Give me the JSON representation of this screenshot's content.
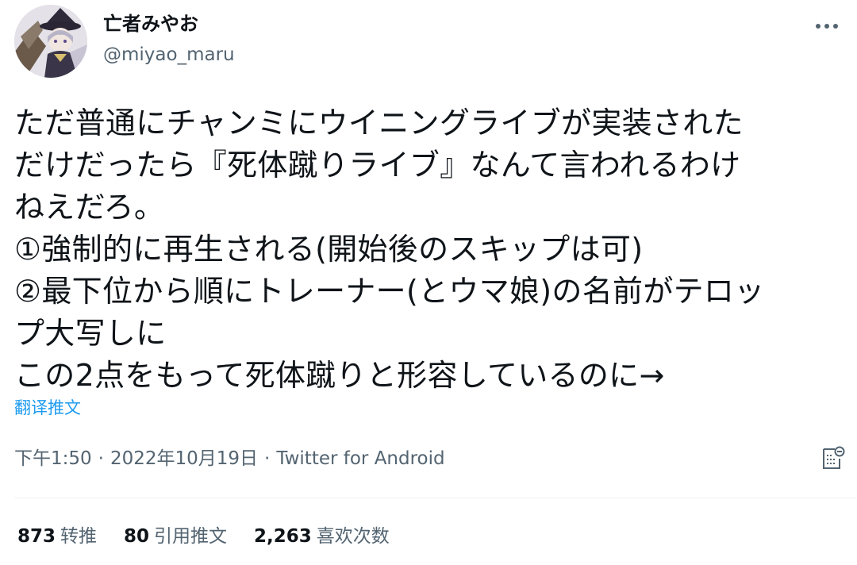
{
  "user": {
    "display_name": "亡者みやお",
    "handle": "@miyao_maru",
    "avatar_icon": "user-avatar"
  },
  "tweet": {
    "text": "ただ普通にチャンミにウイニングライブが実装された\nだけだったら『死体蹴りライブ』なんて言われるわけ\nねえだろ。\n①強制的に再生される(開始後のスキップは可)\n②最下位から順にトレーナー(とウマ娘)の名前がテロッ\nプ大写しに\nこの2点をもって死体蹴りと形容しているのに→",
    "translate_label": "翻译推文"
  },
  "meta": {
    "time": "下午1:50",
    "separator": "·",
    "date": "2022年10月19日",
    "source": "Twitter for Android"
  },
  "stats": {
    "retweets_count": "873",
    "retweets_label": "转推",
    "quotes_count": "80",
    "quotes_label": "引用推文",
    "likes_count": "2,263",
    "likes_label": "喜欢次数"
  },
  "colors": {
    "text": "#0f1419",
    "secondary": "#536471",
    "link": "#1d9bf0",
    "divider": "#eff3f4"
  },
  "icons": {
    "more": "more-horizontal-icon",
    "analytics": "tweet-analytics-icon"
  }
}
